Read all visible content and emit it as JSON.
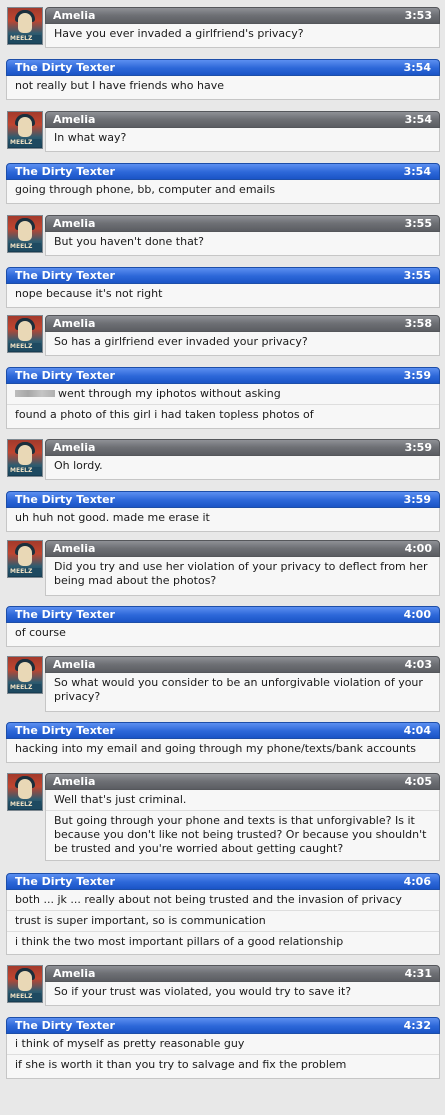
{
  "participants": {
    "amelia": "Amelia",
    "texter": "The Dirty Texter"
  },
  "avatar_tag": "MEELZ",
  "colors": {
    "amelia_header": "#6d6f74",
    "texter_header": "#2c67d8",
    "body_bg": "#f7f7f7"
  },
  "messages": [
    {
      "sender": "Amelia",
      "time": "3:53",
      "lines": [
        "Have you ever invaded a girlfriend's privacy?"
      ]
    },
    {
      "sender": "The Dirty Texter",
      "time": "3:54",
      "lines": [
        "not really but I have friends who have"
      ]
    },
    {
      "sender": "Amelia",
      "time": "3:54",
      "lines": [
        "In what way?"
      ]
    },
    {
      "sender": "The Dirty Texter",
      "time": "3:54",
      "lines": [
        "going through phone, bb, computer and emails"
      ]
    },
    {
      "sender": "Amelia",
      "time": "3:55",
      "lines": [
        "But you haven't done that?"
      ]
    },
    {
      "sender": "The Dirty Texter",
      "time": "3:55",
      "lines": [
        "nope because it's not right"
      ]
    },
    {
      "sender": "Amelia",
      "time": "3:58",
      "lines": [
        "So has a girlfriend ever invaded your privacy?"
      ]
    },
    {
      "sender": "The Dirty Texter",
      "time": "3:59",
      "lines": [
        "went through my iphotos without asking",
        "found a photo of this girl i had taken topless photos of"
      ]
    },
    {
      "sender": "Amelia",
      "time": "3:59",
      "lines": [
        "Oh lordy."
      ]
    },
    {
      "sender": "The Dirty Texter",
      "time": "3:59",
      "lines": [
        "uh huh not good. made me erase it"
      ]
    },
    {
      "sender": "Amelia",
      "time": "4:00",
      "lines": [
        "Did you try and use her violation of your privacy to deflect from her being mad about the photos?"
      ]
    },
    {
      "sender": "The Dirty Texter",
      "time": "4:00",
      "lines": [
        "of course"
      ]
    },
    {
      "sender": "Amelia",
      "time": "4:03",
      "lines": [
        "So what would you consider to be an unforgivable violation of your privacy?"
      ]
    },
    {
      "sender": "The Dirty Texter",
      "time": "4:04",
      "lines": [
        "hacking into my email and going through my phone/texts/bank accounts"
      ]
    },
    {
      "sender": "Amelia",
      "time": "4:05",
      "lines": [
        "Well that's just criminal.",
        "But going through your phone and texts is that unforgivable? Is it because you don't like not being trusted? Or because you shouldn't be trusted and you're worried about getting caught?"
      ]
    },
    {
      "sender": "The Dirty Texter",
      "time": "4:06",
      "lines": [
        "both ... jk ... really about not being trusted and the invasion of privacy",
        "trust is super important, so is communication",
        "i think the two most important pillars of a good relationship"
      ]
    },
    {
      "sender": "Amelia",
      "time": "4:31",
      "lines": [
        "So if your trust was violated, you would try to save it?"
      ]
    },
    {
      "sender": "The Dirty Texter",
      "time": "4:32",
      "lines": [
        "i think of myself as pretty reasonable guy",
        "if she is worth it than you try to salvage and fix the problem"
      ]
    }
  ]
}
